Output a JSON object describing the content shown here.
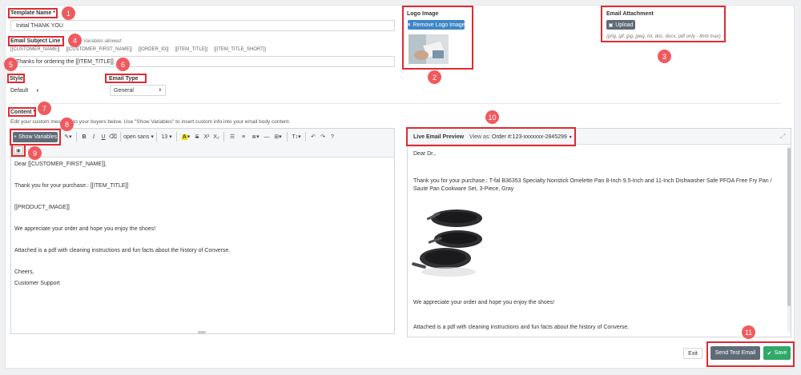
{
  "template_name": {
    "label": "Template Name *",
    "value": "Initial THANK YOU"
  },
  "subject": {
    "label": "Email Subject Line *",
    "hint": "Variables allowed:",
    "variables": [
      "[[CUSTOMER_NAME]]",
      "[[CUSTOMER_FIRST_NAME]]",
      "[[ORDER_ID]]",
      "[[ITEM_TITLE]]",
      "[[ITEM_TITLE_SHORT]]"
    ],
    "value": "Thanks for ordering the [[ITEM_TITLE]]"
  },
  "style": {
    "label": "Style",
    "value": "Default"
  },
  "email_type": {
    "label": "Email Type",
    "value": "General"
  },
  "logo": {
    "label": "Logo Image",
    "remove_label": "Remove Logo Image"
  },
  "attachment": {
    "label": "Email Attachment",
    "upload_label": "Upload",
    "note": "(png, gif, jpg, jpeg, txt, doc, docx, pdf only - 8mb max)"
  },
  "content": {
    "label": "Content *",
    "instructions": "Edit your custom message to your buyers below. Use \"Show Variables\" to insert custom info into your email body content.",
    "show_variables_label": "Show Variables",
    "toolbar": {
      "font": "open sans",
      "size": "13"
    },
    "body": [
      "Dear [[CUSTOMER_FIRST_NAME]],",
      "Thank you for your purchase.: [[ITEM_TITLE]]",
      "[[PRODUCT_IMAGE]]",
      "We appreciate your order and hope you enjoy the shoes!",
      "Attached is a pdf with cleaning instructions and fun facts about the history of Converse.",
      "Cheers,",
      "Customer Support"
    ]
  },
  "preview": {
    "title": "Live Email Preview",
    "view_as_label": "View as:",
    "order_value": "Order #:123-xxxxxxx-2845299",
    "greeting": "Dear Dr.,",
    "purchase": "Thank you for your purchase.: T-fal B36353 Specialty Nonstick Omelette Pan 8-Inch 9.5-Inch and 11-Inch Dishwasher Safe PFOA Free Fry Pan / Saute Pan Cookware Set, 3-Piece, Gray",
    "appreciate": "We appreciate your order and hope you enjoy the shoes!",
    "attached": "Attached is a pdf with cleaning instructions and fun facts about the history of Converse."
  },
  "footer": {
    "exit_label": "Exit",
    "send_test_label": "Send Test Email",
    "save_label": "Save"
  },
  "callouts": [
    "1",
    "2",
    "3",
    "4",
    "5",
    "6",
    "7",
    "8",
    "9",
    "10",
    "11"
  ],
  "colors": {
    "callout": "#f05a5f",
    "highlight": "#e02a33",
    "primary": "#3d86c6",
    "dark_button": "#5f6b76",
    "save": "#2fa86a"
  }
}
